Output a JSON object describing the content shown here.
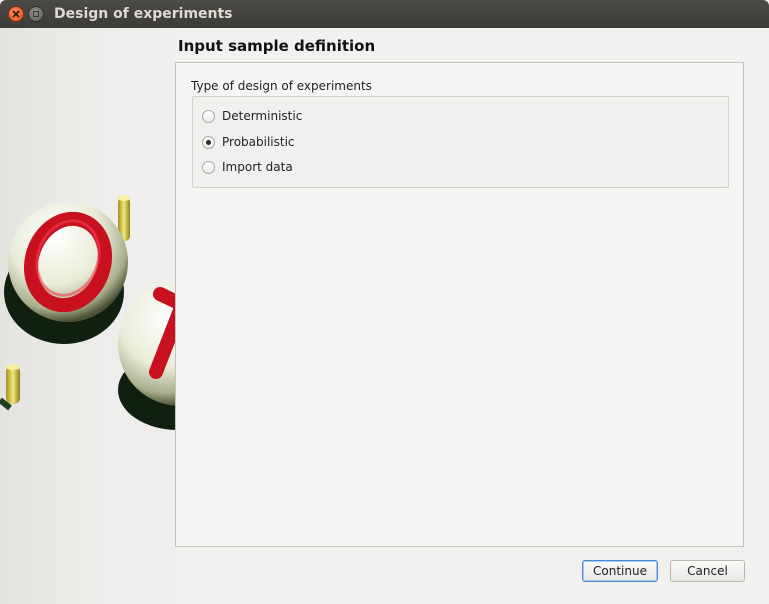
{
  "window": {
    "title": "Design of experiments"
  },
  "page": {
    "heading": "Input sample definition"
  },
  "doe_type": {
    "label": "Type of design of experiments",
    "options": [
      {
        "label": "Deterministic",
        "checked": false
      },
      {
        "label": "Probabilistic",
        "checked": true
      },
      {
        "label": "Import data",
        "checked": false
      }
    ]
  },
  "buttons": {
    "continue": "Continue",
    "cancel": "Cancel"
  },
  "colors": {
    "titlebar": "#3c3b37",
    "close_button": "#e2501c",
    "default_button_border": "#4a8bd6",
    "logo_red": "#c8101e",
    "logo_pin": "#d8c840"
  },
  "icons": {
    "close": "close-icon",
    "maximize": "maximize-icon",
    "logo": "ot-logo-icon"
  }
}
